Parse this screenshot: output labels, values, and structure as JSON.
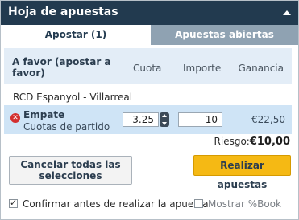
{
  "panel": {
    "title": "Hoja de apuestas"
  },
  "tabs": [
    {
      "label": "Apostar (1)",
      "active": true
    },
    {
      "label": "Apuestas abiertas",
      "active": false
    }
  ],
  "table_header": {
    "favor": "A favor (apostar a favor)",
    "cuota": "Cuota",
    "importe": "Importe",
    "ganancia": "Ganancia"
  },
  "bet": {
    "match": "RCD Espanyol - Villarreal",
    "selection": "Empate",
    "market": "Cuotas de partido",
    "odds": "3.25",
    "stake": "10",
    "profit": "€22,50"
  },
  "risk": {
    "label": "Riesgo:",
    "value": "€10,00"
  },
  "buttons": {
    "cancel_all": "Cancelar todas las selecciones",
    "place_bets": "Realizar apuestas"
  },
  "options": {
    "confirm_label": "Confirmar antes de realizar la apuesta",
    "confirm_checked": true,
    "percent_label": "Mostrar %Book",
    "percent_checked": false
  },
  "colors": {
    "titlebar": "#223a4f",
    "inactive_tab": "#8fa2b2",
    "header_bg": "#e3edf7",
    "bet_row_bg": "#cfe4f6",
    "place_button": "#f5b914",
    "remove_icon": "#d32f2f"
  },
  "icons": {
    "collapse": "caret-up-icon",
    "remove": "remove-x-icon",
    "stepper": "stepper-arrows-icon"
  }
}
